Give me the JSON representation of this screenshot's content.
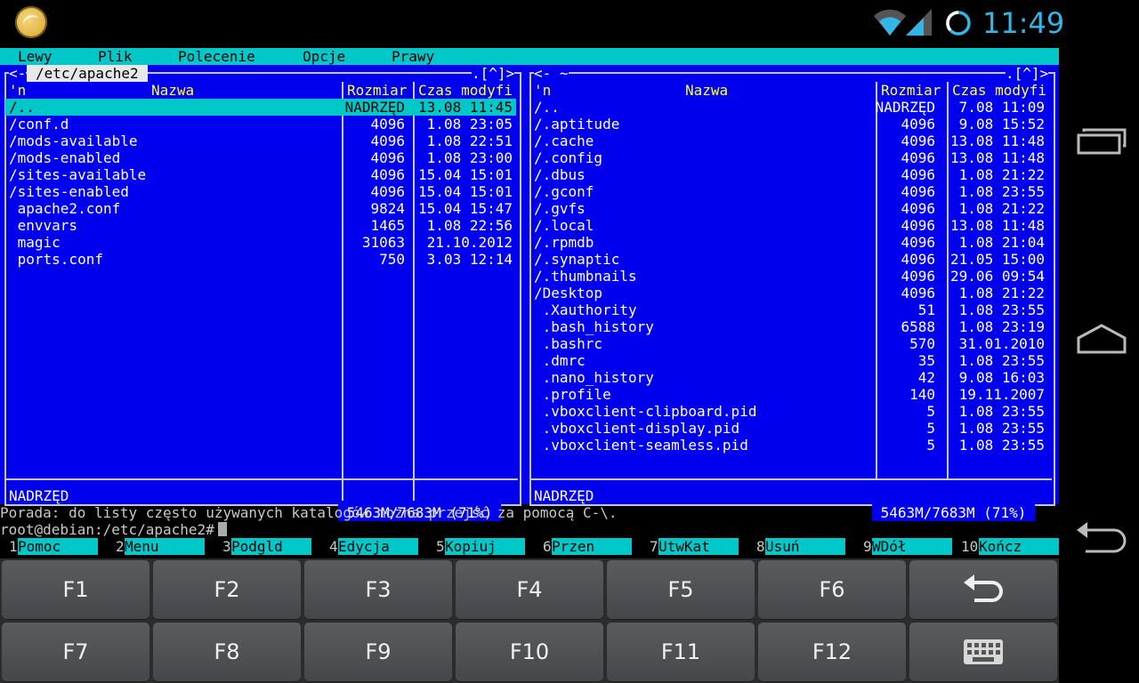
{
  "statusbar": {
    "clock": "11:49",
    "icons": [
      "app-logo-icon",
      "wifi-icon",
      "signal-icon",
      "battery-icon"
    ],
    "accent_color": "#33b5e5"
  },
  "menubar": {
    "items": [
      "Lewy",
      "Plik",
      "Polecenie",
      "Opcje",
      "Prawy"
    ]
  },
  "left_panel": {
    "corner_left": "<-",
    "path": "/etc/apache2",
    "corner_right": ".[^]>",
    "headers": {
      "marker": "'n",
      "name": "Nazwa",
      "size": "Rozmiar",
      "time": "Czas modyfi"
    },
    "rows": [
      {
        "name": "/..",
        "size": "NADRZĘD",
        "time": "13.08 11:45",
        "selected": true
      },
      {
        "name": "/conf.d",
        "size": "4096",
        "time": "1.08 23:05"
      },
      {
        "name": "/mods-available",
        "size": "4096",
        "time": "1.08 22:51"
      },
      {
        "name": "/mods-enabled",
        "size": "4096",
        "time": "1.08 23:00"
      },
      {
        "name": "/sites-available",
        "size": "4096",
        "time": "15.04 15:01"
      },
      {
        "name": "/sites-enabled",
        "size": "4096",
        "time": "15.04 15:01"
      },
      {
        "name": " apache2.conf",
        "size": "9824",
        "time": "15.04 15:47"
      },
      {
        "name": " envvars",
        "size": "1465",
        "time": "1.08 22:56"
      },
      {
        "name": " magic",
        "size": "31063",
        "time": "21.10.2012"
      },
      {
        "name": " ports.conf",
        "size": "750",
        "time": "3.03 12:14"
      }
    ],
    "mini_status": "NADRZĘD",
    "disk_free": " 5463M/7683M (71%) "
  },
  "right_panel": {
    "corner_left": "<- ~",
    "path": "~",
    "corner_right": ".[^]>",
    "headers": {
      "marker": "'n",
      "name": "Nazwa",
      "size": "Rozmiar",
      "time": "Czas modyfi"
    },
    "rows": [
      {
        "name": "/..",
        "size": "NADRZĘD",
        "time": "7.08 11:09"
      },
      {
        "name": "/.aptitude",
        "size": "4096",
        "time": "9.08 15:52"
      },
      {
        "name": "/.cache",
        "size": "4096",
        "time": "13.08 11:48"
      },
      {
        "name": "/.config",
        "size": "4096",
        "time": "13.08 11:48"
      },
      {
        "name": "/.dbus",
        "size": "4096",
        "time": "1.08 21:22"
      },
      {
        "name": "/.gconf",
        "size": "4096",
        "time": "1.08 23:55"
      },
      {
        "name": "/.gvfs",
        "size": "4096",
        "time": "1.08 21:22"
      },
      {
        "name": "/.local",
        "size": "4096",
        "time": "13.08 11:48"
      },
      {
        "name": "/.rpmdb",
        "size": "4096",
        "time": "1.08 21:04"
      },
      {
        "name": "/.synaptic",
        "size": "4096",
        "time": "21.05 15:00"
      },
      {
        "name": "/.thumbnails",
        "size": "4096",
        "time": "29.06 09:54"
      },
      {
        "name": "/Desktop",
        "size": "4096",
        "time": "1.08 21:22"
      },
      {
        "name": " .Xauthority",
        "size": "51",
        "time": "1.08 23:55"
      },
      {
        "name": " .bash_history",
        "size": "6588",
        "time": "1.08 23:19"
      },
      {
        "name": " .bashrc",
        "size": "570",
        "time": "31.01.2010"
      },
      {
        "name": " .dmrc",
        "size": "35",
        "time": "1.08 23:55"
      },
      {
        "name": " .nano_history",
        "size": "42",
        "time": "9.08 16:03"
      },
      {
        "name": " .profile",
        "size": "140",
        "time": "19.11.2007"
      },
      {
        "name": " .vboxclient-clipboard.pid",
        "size": "5",
        "time": "1.08 23:55"
      },
      {
        "name": " .vboxclient-display.pid",
        "size": "5",
        "time": "1.08 23:55"
      },
      {
        "name": " .vboxclient-seamless.pid",
        "size": "5",
        "time": "1.08 23:55"
      }
    ],
    "mini_status": "NADRZĘD",
    "disk_free": " 5463M/7683M (71%) "
  },
  "hint": "Porada: do listy często używanych katalogów można przejść za pomocą C-\\.",
  "prompt": "root@debian:/etc/apache2#",
  "fkeys": [
    {
      "num": "1",
      "label": "Pomoc"
    },
    {
      "num": "2",
      "label": "Menu"
    },
    {
      "num": "3",
      "label": "Podgld"
    },
    {
      "num": "4",
      "label": "Edycja"
    },
    {
      "num": "5",
      "label": "Kopiuj"
    },
    {
      "num": "6",
      "label": "Przen"
    },
    {
      "num": "7",
      "label": "UtwKat"
    },
    {
      "num": "8",
      "label": "Usuń"
    },
    {
      "num": "9",
      "label": "WDół"
    },
    {
      "num": "10",
      "label": "Kończ"
    }
  ],
  "keyboard": {
    "row1": [
      "F1",
      "F2",
      "F3",
      "F4",
      "F5",
      "F6"
    ],
    "row2": [
      "F7",
      "F8",
      "F9",
      "F10",
      "F11",
      "F12"
    ],
    "back_key_icon": "undo-arrow-icon",
    "keyboard_key_icon": "keyboard-icon"
  },
  "navbar": {
    "icons": [
      "recent-apps-icon",
      "home-icon",
      "back-icon"
    ]
  },
  "colors": {
    "panel_bg": "#0000ee",
    "header_fg": "#ffff54",
    "selection_bg": "#00c8c8",
    "menubar_bg": "#00c8c8"
  }
}
